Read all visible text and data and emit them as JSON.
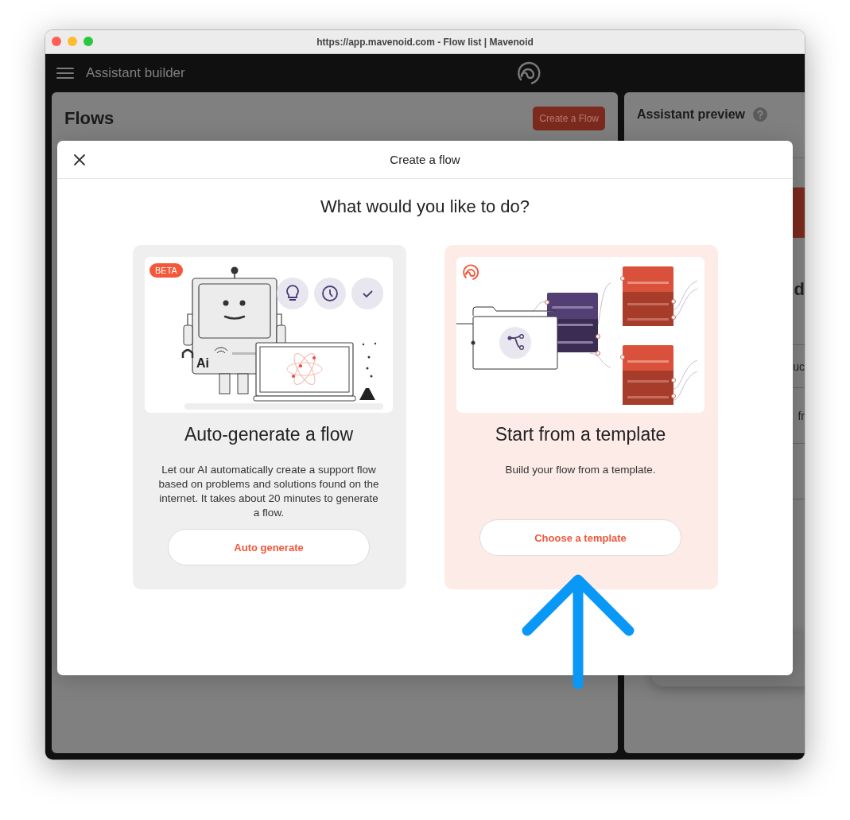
{
  "window": {
    "title": "https://app.mavenoid.com - Flow list | Mavenoid"
  },
  "app_bar": {
    "title": "Assistant builder"
  },
  "flows_panel": {
    "title": "Flows",
    "create_button": "Create a Flow"
  },
  "preview_panel": {
    "title": "Assistant preview",
    "fragments": [
      "d",
      "uc",
      "fr"
    ]
  },
  "modal": {
    "title": "Create a flow",
    "question": "What would you like to do?",
    "options": [
      {
        "kind": "auto",
        "badge": "BETA",
        "illustration_label": "Ai",
        "title": "Auto-generate a flow",
        "description": "Let our AI automatically create a support flow based on problems and solutions found on the internet. It takes about 20 minutes to generate a flow.",
        "button": "Auto generate",
        "selected": false
      },
      {
        "kind": "template",
        "title": "Start from a template",
        "description": "Build your flow from a template.",
        "button": "Choose a template",
        "selected": true
      }
    ]
  }
}
